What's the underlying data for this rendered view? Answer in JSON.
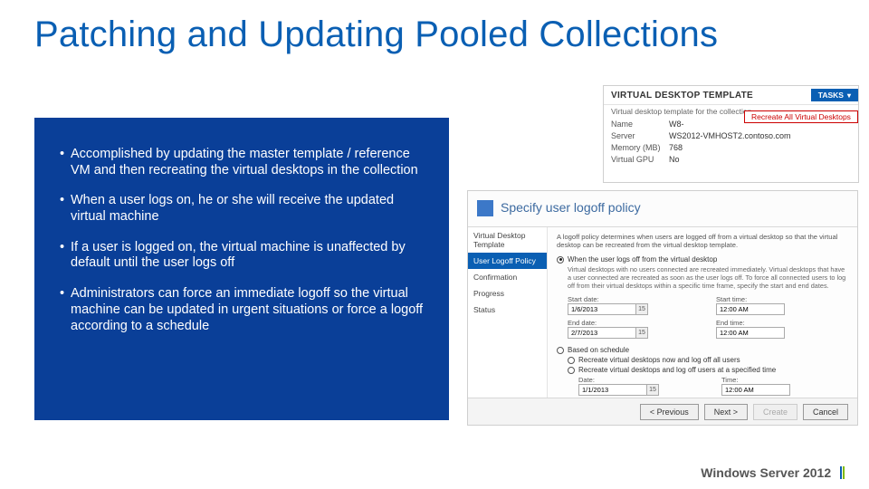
{
  "title": "Patching and Updating Pooled Collections",
  "bullets": [
    "Accomplished by updating the master template  / reference VM and then recreating the virtual desktops in the collection",
    "When a user logs on, he or she will receive the updated virtual machine",
    "If a user is logged on, the virtual machine is unaffected by default until the user logs off",
    "Administrators can force an immediate logoff so the virtual machine can be updated in urgent situations or force a logoff according to a schedule"
  ],
  "vdt": {
    "title": "VIRTUAL DESKTOP TEMPLATE",
    "subtitle": "Virtual desktop template for the collection",
    "tasks_label": "TASKS",
    "recreate_label": "Recreate All Virtual Desktops",
    "rows": {
      "name_label": "Name",
      "name_value": "W8-",
      "server_label": "Server",
      "server_value": "WS2012-VMHOST2.contoso.com",
      "memory_label": "Memory (MB)",
      "memory_value": "768",
      "vgpu_label": "Virtual GPU",
      "vgpu_value": "No"
    }
  },
  "wizard": {
    "title": "Specify user logoff policy",
    "nav": {
      "items": [
        "Virtual Desktop Template",
        "User Logoff Policy",
        "Confirmation",
        "Progress",
        "Status"
      ],
      "active_index": 1
    },
    "intro": "A logoff policy determines when users are logged off from a virtual desktop so that the virtual desktop can be recreated from the virtual desktop template.",
    "opt1": {
      "label": "When the user logs off from the virtual desktop",
      "helper": "Virtual desktops with no users connected are recreated immediately. Virtual desktops that have a user connected are recreated as soon as the user logs off. To force all connected users to log off from their virtual desktops within a specific time frame, specify the start and end dates.",
      "start_date_label": "Start date:",
      "start_date_value": "1/6/2013",
      "start_time_label": "Start time:",
      "start_time_value": "12:00 AM",
      "end_date_label": "End date:",
      "end_date_value": "2/7/2013",
      "end_time_label": "End time:",
      "end_time_value": "12:00 AM"
    },
    "opt2": {
      "label": "Based on schedule",
      "sub1": "Recreate virtual desktops now and log off all users",
      "sub2": "Recreate virtual desktops and log off users at a specified time",
      "date_label": "Date:",
      "date_value": "1/1/2013",
      "time_label": "Time:",
      "time_value": "12:00 AM"
    },
    "buttons": {
      "previous": "< Previous",
      "next": "Next >",
      "create": "Create",
      "cancel": "Cancel"
    }
  },
  "brand": "Windows Server 2012"
}
